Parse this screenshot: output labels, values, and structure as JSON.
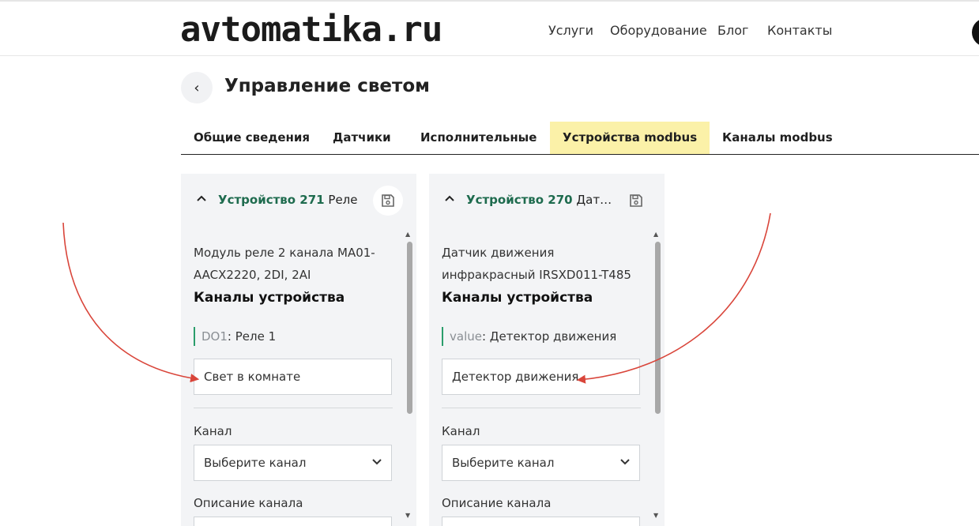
{
  "header": {
    "logo": "avtomatika.ru",
    "nav": [
      "Услуги",
      "Оборудование",
      "Блог",
      "Контакты"
    ]
  },
  "page": {
    "back_icon": "‹",
    "title": "Управление светом"
  },
  "tabs": [
    {
      "label": "Общие сведения",
      "active": false
    },
    {
      "label": "Датчики",
      "active": false
    },
    {
      "label": "Исполнительные",
      "active": false
    },
    {
      "label": "Устройства modbus",
      "active": true
    },
    {
      "label": "Каналы modbus",
      "active": false
    }
  ],
  "cards": [
    {
      "device_id": "Устройство 271",
      "device_type": "Реле",
      "description": "Модуль реле 2 канала MA01-AACX2220, 2DI, 2AI",
      "section_title": "Каналы устройства",
      "channel_key": "DO1",
      "channel_value": ": Реле 1",
      "channel_name": "Свет в комнате",
      "channel_label": "Канал",
      "channel_select": "Выберите канал",
      "channel_desc_label": "Описание канала"
    },
    {
      "device_id": "Устройство 270",
      "device_type": "Датчик движения",
      "description": "Датчик движения инфракрасный IRSXD011-T485",
      "section_title": "Каналы устройства",
      "channel_key": "value",
      "channel_value": ": Детектор движения",
      "channel_name": "Детектор движения",
      "channel_label": "Канал",
      "channel_select": "Выберите канал",
      "channel_desc_label": "Описание канала"
    }
  ],
  "colors": {
    "accent_green": "#1e6b4e",
    "active_tab": "#fbf1a8",
    "annotation_arrow": "#d9453a"
  }
}
